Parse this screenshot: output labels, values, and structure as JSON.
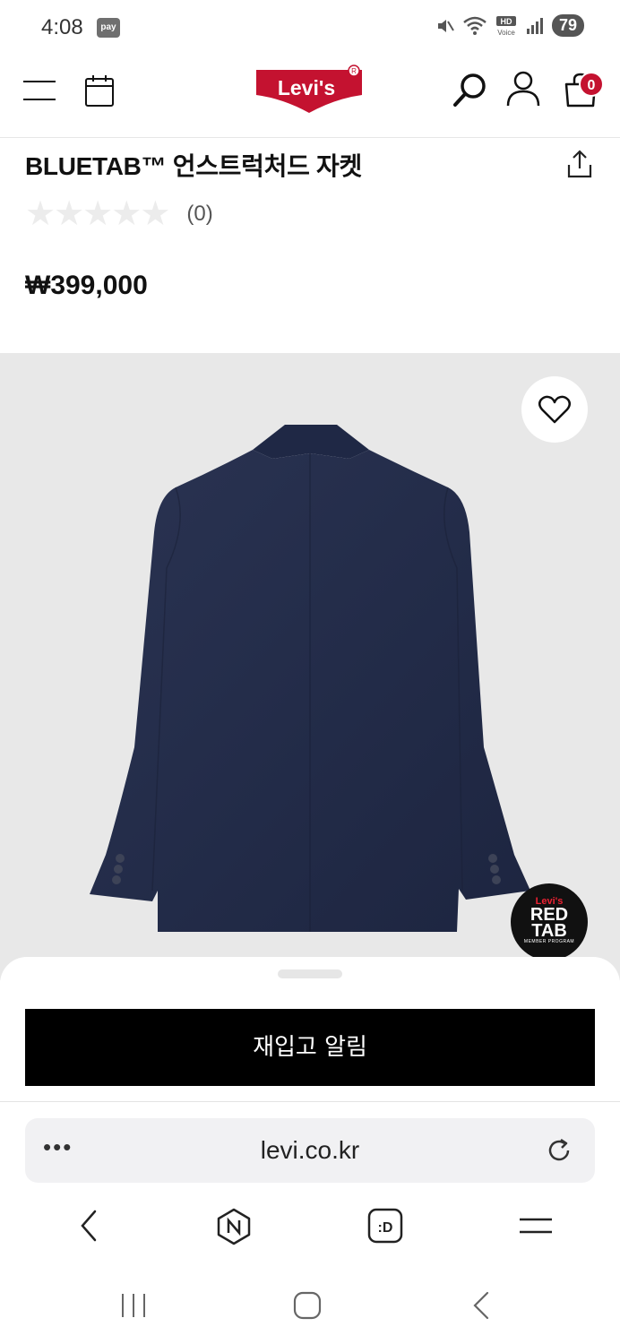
{
  "status_bar": {
    "time": "4:08",
    "pay_label": "pay",
    "hd_label": "HD",
    "voice_label": "Voice",
    "battery": "79"
  },
  "header": {
    "logo_text": "Levi's",
    "cart_count": "0",
    "brand_color": "#c41230"
  },
  "product": {
    "title": "BLUETAB™ 언스트럭처드 자켓",
    "rating_stars": 0,
    "review_count": "(0)",
    "price": "₩399,000",
    "image_alt": "dark indigo denim jacket, back view"
  },
  "badge": {
    "line1": "Levi's",
    "line2a": "RED",
    "line2b": "TAB",
    "line3": "MEMBER PROGRAM"
  },
  "bottom_sheet": {
    "notify_button_label": "재입고 알림"
  },
  "browser": {
    "url": "levi.co.kr",
    "more_dots": "•••"
  }
}
